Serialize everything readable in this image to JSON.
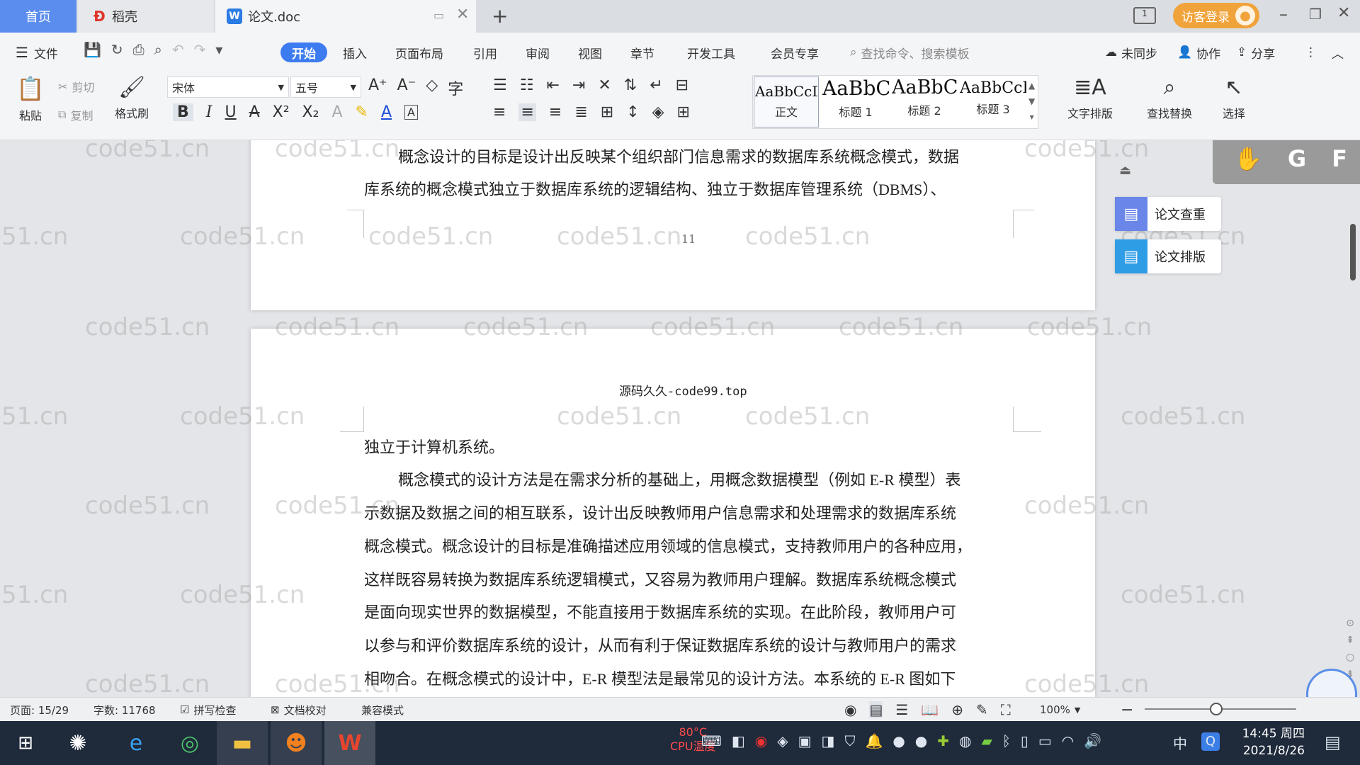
{
  "tabs": {
    "home": "首页",
    "daoke": "稻壳",
    "doc": "论文.doc"
  },
  "titlebar": {
    "login": "访客登录"
  },
  "menu": {
    "file": "文件",
    "items": [
      "开始",
      "插入",
      "页面布局",
      "引用",
      "审阅",
      "视图",
      "章节",
      "开发工具",
      "会员专享"
    ],
    "search_placeholder": "查找命令、搜索模板",
    "sync": "未同步",
    "collab": "协作",
    "share": "分享"
  },
  "toolbar": {
    "paste": "粘贴",
    "cut": "剪切",
    "copy": "复制",
    "format_painter": "格式刷",
    "font_name": "宋体",
    "font_size": "五号",
    "styles": [
      {
        "sample": "AaBbCcDd",
        "name": "正文"
      },
      {
        "sample": "AaBbC",
        "name": "标题 1"
      },
      {
        "sample": "AaBbC",
        "name": "标题 2"
      },
      {
        "sample": "AaBbCcI",
        "name": "标题 3"
      }
    ],
    "text_layout": "文字排版",
    "find_replace": "查找替换",
    "select": "选择"
  },
  "document": {
    "page1_lines": [
      "概念设计的目标是设计出反映某个组织部门信息需求的数据库系统概念模式，数据",
      "库系统的概念模式独立于数据库系统的逻辑结构、独立于数据库管理系统（DBMS）、"
    ],
    "page_number": "11",
    "header_text": "源码久久-code99.top",
    "page2_lines": [
      "独立于计算机系统。",
      "概念模式的设计方法是在需求分析的基础上，用概念数据模型（例如 E-R 模型）表",
      "示数据及数据之间的相互联系，设计出反映教师用户信息需求和处理需求的数据库系统",
      "概念模式。概念设计的目标是准确描述应用领域的信息模式，支持教师用户的各种应用，",
      "这样既容易转换为数据库系统逻辑模式，又容易为教师用户理解。数据库系统概念模式",
      "是面向现实世界的数据模型，不能直接用于数据库系统的实现。在此阶段，教师用户可",
      "以参与和评价数据库系统的设计，从而有利于保证数据库系统的设计与教师用户的需求",
      "相吻合。在概念模式的设计中，E-R 模型法是最常见的设计方法。本系统的 E-R 图如下"
    ],
    "watermark": "code51.cn"
  },
  "side_panel": {
    "check": "论文查重",
    "layout": "论文排版"
  },
  "float_toolbar": {
    "g": "G",
    "f": "F"
  },
  "status": {
    "page": "页面: 15/29",
    "words": "字数: 11768",
    "spell": "拼写检查",
    "proof": "文档校对",
    "compat": "兼容模式",
    "zoom": "100%"
  },
  "taskbar": {
    "temp": "80°C",
    "cpu": "CPU温度",
    "ime": "中",
    "time": "14:45 周四",
    "date": "2021/8/26"
  },
  "colors": {
    "accent": "#3d7cf0",
    "wps_red": "#d8332b"
  }
}
